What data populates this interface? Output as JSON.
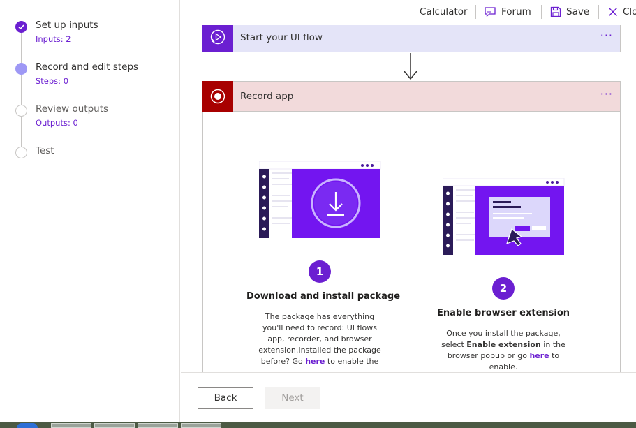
{
  "sidebar": {
    "steps": [
      {
        "title": "Set up inputs",
        "subtitle": "Inputs: 2",
        "state": "done"
      },
      {
        "title": "Record and edit steps",
        "subtitle": "Steps: 0",
        "state": "current"
      },
      {
        "title": "Review outputs",
        "subtitle": "Outputs: 0",
        "state": "todo"
      },
      {
        "title": "Test",
        "subtitle": "",
        "state": "todo"
      }
    ]
  },
  "topbar": {
    "app_name": "Calculator",
    "forum_label": "Forum",
    "save_label": "Save",
    "close_label": "Clo"
  },
  "canvas": {
    "start_card": {
      "label": "Start your UI flow",
      "more": "···"
    },
    "record_card": {
      "label": "Record app",
      "more": "···"
    },
    "step1": {
      "number": "1",
      "title": "Download and install package",
      "text_a": "The package has everything you'll need to record: UI flows app, recorder, and browser extension.Installed the package before? Go ",
      "link": "here",
      "text_b": " to enable the"
    },
    "step2": {
      "number": "2",
      "title": "Enable browser extension",
      "text_a": "Once you install the package, select ",
      "bold": "Enable extension",
      "text_b": " in the browser popup or go ",
      "link": "here",
      "text_c": " to enable."
    }
  },
  "footer": {
    "back_label": "Back",
    "next_label": "Next"
  },
  "colors": {
    "accent": "#6b1fd1",
    "record_red": "#a80000",
    "start_header_bg": "#e4e4f8",
    "record_header_bg": "#f2dadb"
  }
}
